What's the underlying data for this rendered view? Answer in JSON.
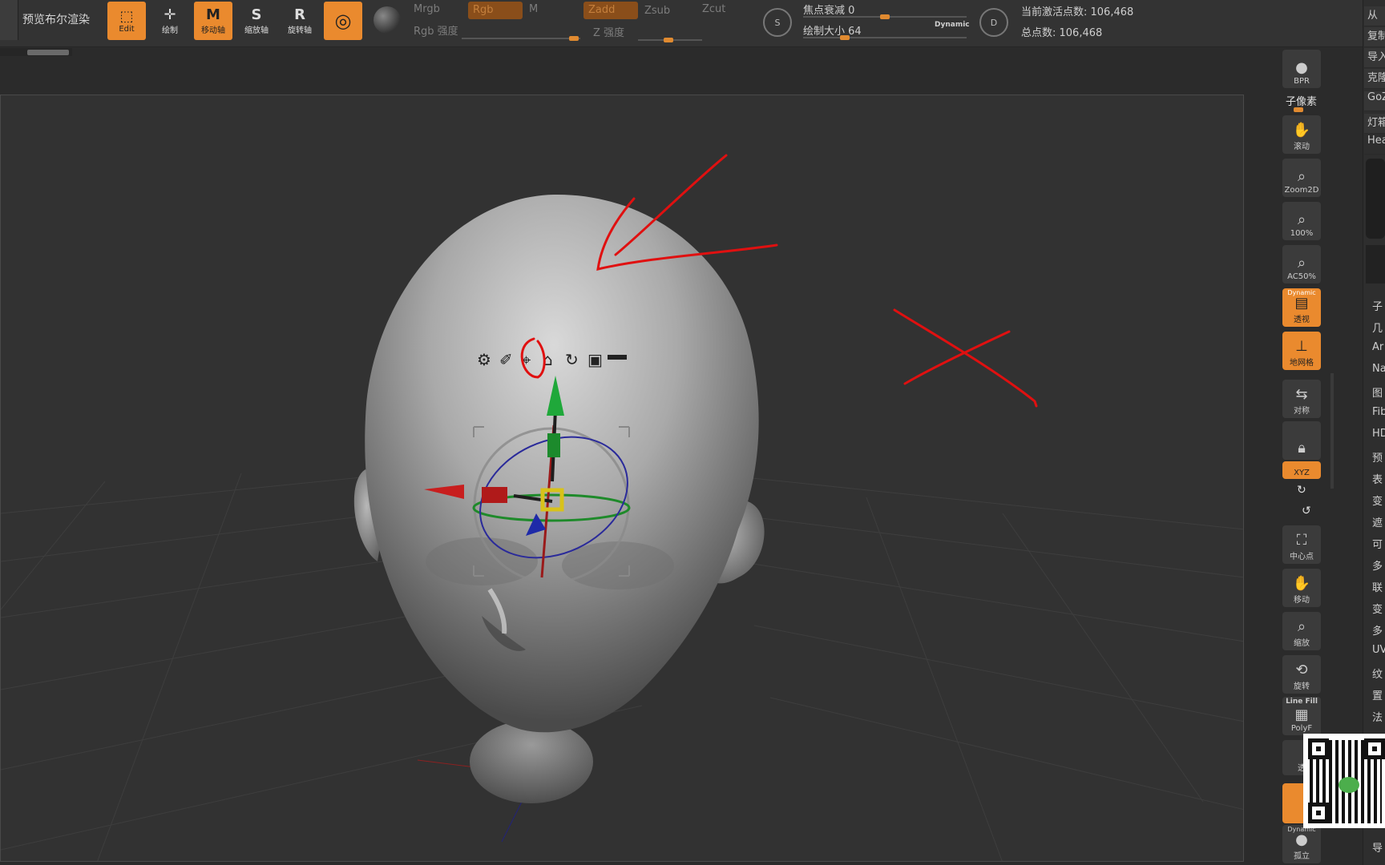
{
  "topbar": {
    "preview_label": "预览布尔渲染",
    "tools": {
      "edit": "Edit",
      "draw": "绘制",
      "move": "移动轴",
      "scale": "缩放轴",
      "rotate": "旋转轴"
    },
    "tool_letters": {
      "move": "M",
      "scale": "S",
      "rotate": "R"
    },
    "mrgb": "Mrgb",
    "rgb": "Rgb",
    "m": "M",
    "zadd": "Zadd",
    "zsub": "Zsub",
    "zcut": "Zcut",
    "rgb_intensity": "Rgb 强度",
    "z_intensity": "Z 强度",
    "focal_shift": "焦点衰减 0",
    "draw_size": "绘制大小 64",
    "dynamic": "Dynamic",
    "active_points": "当前激活点数: 106,468",
    "total_points": "总点数: 106,468",
    "circle_s": "S",
    "circle_d": "D"
  },
  "right_toolbar": {
    "bpr": "BPR",
    "subpixel": "子像素",
    "scroll": "滚动",
    "zoom2d": "Zoom2D",
    "zoom100": "100%",
    "ac50": "AC50%",
    "persp": "透视",
    "persp_top": "Dynamic",
    "floor": "地网格",
    "local": "对称",
    "xyz": "XYZ",
    "center": "中心点",
    "move": "移动",
    "scale": "缩放",
    "rotate": "旋转",
    "linefill_top": "Line Fill",
    "polyf": "PolyF",
    "transp": "透",
    "dynamic_bottom": "Dynamic",
    "solo": "孤立"
  },
  "right_column": {
    "top_items": [
      "从",
      "复制",
      "导入",
      "克隆",
      "GoZ",
      "灯箱",
      "Hea"
    ],
    "list_items": [
      "子",
      "几",
      "Ar",
      "Na",
      "图",
      "Fib",
      "HD",
      "预",
      "表",
      "变",
      "遮",
      "可",
      "多",
      "联",
      "变",
      "多",
      "UV",
      "纹",
      "置",
      "法"
    ],
    "bottom": "导"
  },
  "colors": {
    "accent": "#ea8a2e",
    "annotation_red": "#e01010"
  },
  "icons": [
    "gear-icon",
    "pin-icon",
    "location-icon",
    "home-icon",
    "reset-icon",
    "lock-icon",
    "bar-icon"
  ]
}
